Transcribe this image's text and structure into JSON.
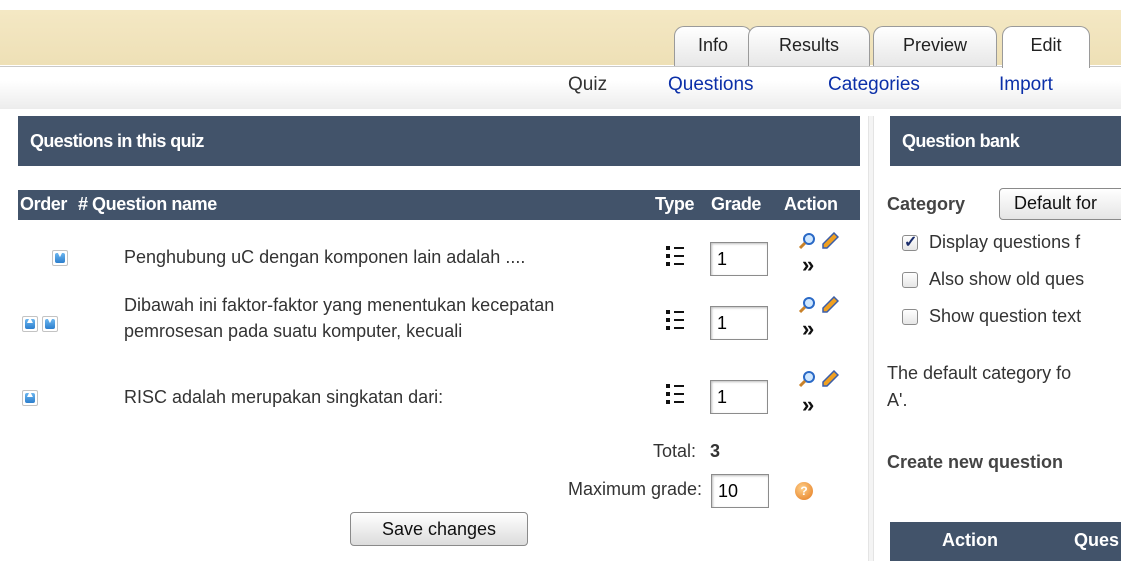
{
  "tabs": [
    {
      "label": "Info"
    },
    {
      "label": "Results"
    },
    {
      "label": "Preview"
    },
    {
      "label": "Edit",
      "active": true
    }
  ],
  "subtabs": [
    {
      "label": "Quiz",
      "current": true
    },
    {
      "label": "Questions"
    },
    {
      "label": "Categories"
    },
    {
      "label": "Import"
    }
  ],
  "left_panel": {
    "title": "Questions in this quiz",
    "columns": [
      "Order",
      "#",
      "Question name",
      "Type",
      "Grade",
      "Action"
    ],
    "rows": [
      {
        "name": "Penghubung uC dengan komponen lain adalah ....",
        "grade": "1",
        "move_up": false,
        "move_down": true
      },
      {
        "name_line1": "Dibawah ini faktor-faktor yang menentukan kecepatan",
        "name_line2": "pemrosesan pada suatu komputer, kecuali",
        "grade": "1",
        "move_up": true,
        "move_down": true
      },
      {
        "name": "RISC adalah merupakan singkatan dari:",
        "grade": "1",
        "move_up": true,
        "move_down": false
      }
    ],
    "move_glyph": "»",
    "total_label": "Total:",
    "total_value": "3",
    "max_grade_label": "Maximum grade:",
    "max_grade_value": "10",
    "save_label": "Save changes"
  },
  "right_panel": {
    "title": "Question bank",
    "category_label": "Category",
    "category_value": "Default for",
    "checkboxes": [
      {
        "label": "Display questions f",
        "checked": true
      },
      {
        "label": "Also show old ques",
        "checked": false
      },
      {
        "label": "Show question text",
        "checked": false
      }
    ],
    "note_line1": "The default category fo",
    "note_line2": "A'.",
    "create_new": "Create new question",
    "table_head": {
      "action": "Action",
      "question": "Ques"
    }
  },
  "colors": {
    "header_bg": "#42536a",
    "link": "#0b2fa8",
    "tab_band": "#f1e4bd"
  }
}
